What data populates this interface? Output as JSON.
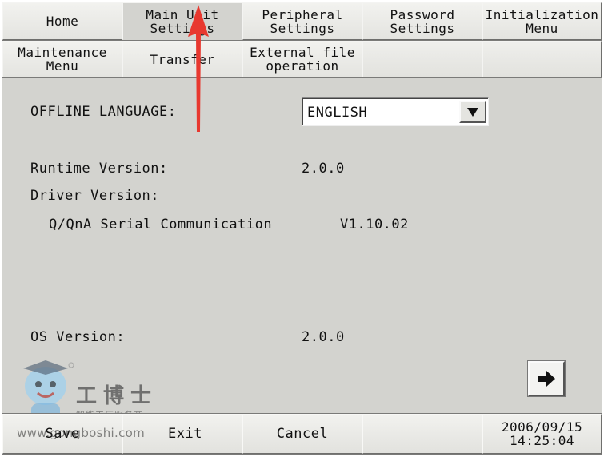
{
  "tabs_row1": [
    {
      "label": "Home",
      "active": false
    },
    {
      "label": "Main Unit\nSettings",
      "active": true
    },
    {
      "label": "Peripheral\nSettings",
      "active": false
    },
    {
      "label": "Password\nSettings",
      "active": false
    },
    {
      "label": "Initialization\nMenu",
      "active": false
    }
  ],
  "tabs_row2": [
    {
      "label": "Maintenance\nMenu"
    },
    {
      "label": "Transfer"
    },
    {
      "label": "External file\noperation"
    },
    {
      "label": ""
    },
    {
      "label": ""
    }
  ],
  "language": {
    "label": "OFFLINE LANGUAGE:",
    "value": "ENGLISH"
  },
  "runtime": {
    "label": "Runtime Version:",
    "value": "2.0.0"
  },
  "driver": {
    "label": "Driver Version:",
    "name": "Q/QnA Serial Communication",
    "value": "V1.10.02"
  },
  "os": {
    "label": "OS Version:",
    "value": "2.0.0"
  },
  "bottom_bar": {
    "save": "Save",
    "exit": "Exit",
    "cancel": "Cancel",
    "clock": "2006/09/15\n14:25:04"
  },
  "watermark": {
    "brand": "工博士",
    "subtitle": "智能工厂服务商",
    "url": "www.gongboshi.com"
  },
  "icons": {
    "dropdown": "triangle-down-icon",
    "next": "arrow-right-icon",
    "annotation": "red-arrow-up-icon"
  },
  "colors": {
    "panel": "#d3d3cf",
    "annotation_arrow": "#e8382f"
  }
}
